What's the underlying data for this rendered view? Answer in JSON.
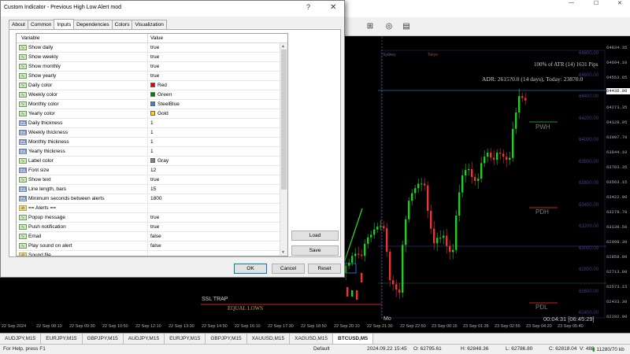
{
  "app": {
    "min_glyph": "—",
    "max_glyph": "☐",
    "close_glyph": "✕"
  },
  "chart": {
    "price_labels": [
      "64834.35",
      "64694.10",
      "64553.85",
      "64436.90",
      "64273.35",
      "64128.95",
      "63987.70",
      "63844.10",
      "63703.35",
      "63563.15",
      "63422.90",
      "63278.70",
      "63139.50",
      "62998.30",
      "62858.00",
      "62713.00",
      "62573.15",
      "62433.30",
      "62292.90"
    ],
    "current_price": "64436.90",
    "time_labels": [
      "22 Sep 2024",
      "22 Sep 08:10",
      "22 Sep 09:30",
      "22 Sep 10:50",
      "22 Sep 12:10",
      "22 Sep 13:30",
      "22 Sep 14:50",
      "22 Sep 16:10",
      "22 Sep 17:30",
      "22 Sep 18:50",
      "22 Sep 20:10",
      "22 Sep 21:30",
      "22 Sep 22:50",
      "23 Sep 00:15",
      "23 Sep 01:35",
      "23 Sep 02:55",
      "23 Sep 04:20",
      "23 Sep 05:40"
    ],
    "atr_text": "100% of ATR (14) 1631 Pips",
    "adr_text": "ADR: 2615?0.0 (14 days), Today: 23870.0",
    "pwh": "PWH",
    "pdh": "PDH",
    "pdl": "PDL",
    "ssl_trap": "SSL TRAP",
    "equal_lows": "EQUAL LOWS",
    "mo": "Mo",
    "countdown": "00:04:31 [06:45:29]",
    "sydney": "Sydney",
    "tokyo": "Tokyo",
    "purple_levels": [
      "64800.00",
      "64600.00",
      "64400.00",
      "64200.00",
      "64000.00",
      "63800.00",
      "63600.00",
      "63400.00",
      "63200.00",
      "63000.00",
      "62800.00",
      "62600.00",
      "62400.00"
    ]
  },
  "symbol_tabs": [
    "AUDJPY,M15",
    "EURJPY,M15",
    "GBPJPY,M15",
    "AUDJPY,M15",
    "EURJPY,M15",
    "GBPJPY,M15",
    "XAUUSD,M15",
    "XAGUSD,M15",
    "BTCUSD,M5"
  ],
  "active_tab_index": 8,
  "status": {
    "help": "For Help, press F1",
    "profile": "Default",
    "datetime": "2024.09.22 15:45",
    "open": "O: 62795.61",
    "high": "H: 62848.36",
    "low": "L: 62786.80",
    "close": "C: 62818.04",
    "volume": "V: 488",
    "traffic": "11280/70 kb"
  },
  "dialog": {
    "title": "Custom Indicator - Previous High Low Alert mod",
    "help_glyph": "?",
    "close_glyph": "✕",
    "tabs": [
      "About",
      "Common",
      "Inputs",
      "Dependencies",
      "Colors",
      "Visualization"
    ],
    "active_tab": 2,
    "col_variable": "Variable",
    "col_value": "Value",
    "rows": [
      {
        "name": "Show daily",
        "value": "true",
        "icon": "bool"
      },
      {
        "name": "Show weekly",
        "value": "true",
        "icon": "bool"
      },
      {
        "name": "Show monthly",
        "value": "true",
        "icon": "bool"
      },
      {
        "name": "Show yearly",
        "value": "true",
        "icon": "bool"
      },
      {
        "name": "Daily color",
        "value": "Red",
        "icon": "bool",
        "swatch": "#ee0000"
      },
      {
        "name": "Weekly color",
        "value": "Green",
        "icon": "bool",
        "swatch": "#008000"
      },
      {
        "name": "Monthly color",
        "value": "SteelBlue",
        "icon": "bool",
        "swatch": "#4682b4"
      },
      {
        "name": "Yearly color",
        "value": "Gold",
        "icon": "bool",
        "swatch": "#ffd700"
      },
      {
        "name": "Daily thickness",
        "value": "1",
        "icon": "int"
      },
      {
        "name": "Weekly thickness",
        "value": "1",
        "icon": "int"
      },
      {
        "name": "Monthly thickness",
        "value": "1",
        "icon": "int"
      },
      {
        "name": "Yearly thickness",
        "value": "1",
        "icon": "int"
      },
      {
        "name": "Label color",
        "value": "Gray",
        "icon": "bool",
        "swatch": "#808080"
      },
      {
        "name": "Font size",
        "value": "12",
        "icon": "int"
      },
      {
        "name": "Show text",
        "value": "true",
        "icon": "bool"
      },
      {
        "name": "Line length, bars",
        "value": "15",
        "icon": "int"
      },
      {
        "name": "Minimum seconds between alerts",
        "value": "1800",
        "icon": "int"
      },
      {
        "name": "== Alerts ==",
        "value": "",
        "icon": "sec"
      },
      {
        "name": "Popup message",
        "value": "true",
        "icon": "bool"
      },
      {
        "name": "Push notification",
        "value": "true",
        "icon": "bool"
      },
      {
        "name": "Email",
        "value": "false",
        "icon": "bool"
      },
      {
        "name": "Play sound on alert",
        "value": "false",
        "icon": "bool"
      },
      {
        "name": "Sound file",
        "value": "",
        "icon": "sec"
      }
    ],
    "load_label": "Load",
    "save_label": "Save",
    "ok_label": "OK",
    "cancel_label": "Cancel",
    "reset_label": "Reset"
  }
}
